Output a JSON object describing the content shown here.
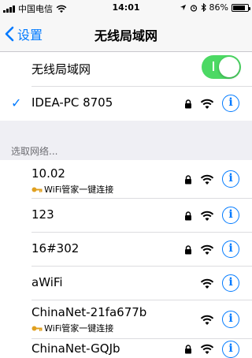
{
  "status_bar": {
    "carrier": "中国电信",
    "time": "14:01",
    "battery": "86%",
    "battery_level": 0.86
  },
  "nav": {
    "back_label": "设置",
    "title": "无线局域网"
  },
  "wlan_toggle": {
    "label": "无线局域网",
    "on": true
  },
  "connected": {
    "name": "IDEA-PC 8705",
    "locked": true
  },
  "section_header": "选取网络...",
  "networks": [
    {
      "name": "10.02",
      "sub": "WiFi管家一键连接",
      "locked": true
    },
    {
      "name": "123",
      "sub": "",
      "locked": true
    },
    {
      "name": "16#302",
      "sub": "",
      "locked": true
    },
    {
      "name": "aWiFi",
      "sub": "",
      "locked": false
    },
    {
      "name": "ChinaNet-21fa677b",
      "sub": "WiFi管家一键连接",
      "locked": false
    },
    {
      "name": "ChinaNet-GQJb",
      "sub": "",
      "locked": true
    }
  ],
  "colors": {
    "accent": "#007aff",
    "toggle_on": "#4cd964",
    "key_icon": "#e0a020"
  }
}
